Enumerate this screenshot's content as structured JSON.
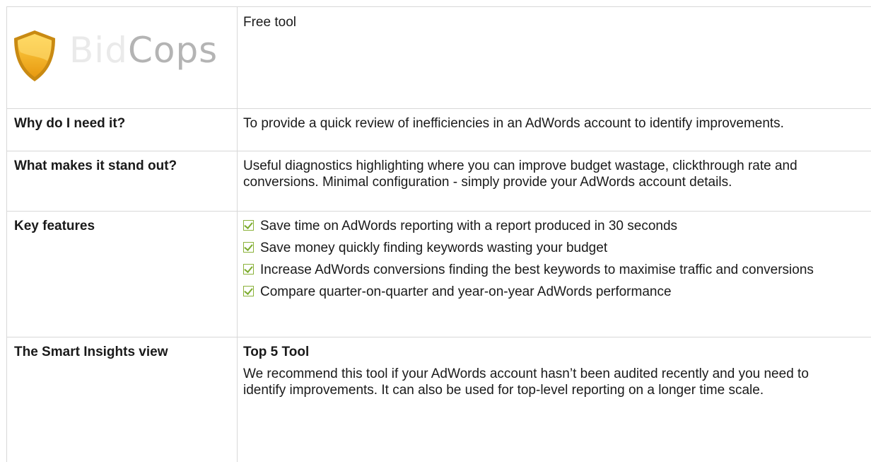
{
  "header": {
    "logo_text_faint": "Bid",
    "logo_text": "Cops",
    "subtitle": "Free tool"
  },
  "rows": {
    "why": {
      "label": "Why do I need it?",
      "value": "To provide a quick review of inefficiencies in an AdWords account to identify improvements."
    },
    "standout": {
      "label": "What makes it stand out?",
      "value": "Useful diagnostics highlighting where you can improve budget wastage, clickthrough rate and conversions. Minimal configuration - simply provide your AdWords account details."
    },
    "features": {
      "label": "Key features",
      "items": [
        "Save time on AdWords reporting with a report produced in 30 seconds",
        "Save money quickly finding keywords wasting your budget",
        "Increase AdWords conversions finding the best keywords to maximise traffic and conversions",
        "Compare quarter-on-quarter and year-on-year AdWords performance"
      ]
    },
    "view": {
      "label": "The Smart Insights view",
      "heading": "Top 5 Tool",
      "value": "We recommend this tool if your AdWords account hasn’t been audited recently and you need to identify improvements. It can also be used for top-level reporting on a longer time scale."
    }
  },
  "colors": {
    "shield_gold": "#f2b01e",
    "check_green": "#7cab2e",
    "grid_line": "#d8d8d8"
  }
}
